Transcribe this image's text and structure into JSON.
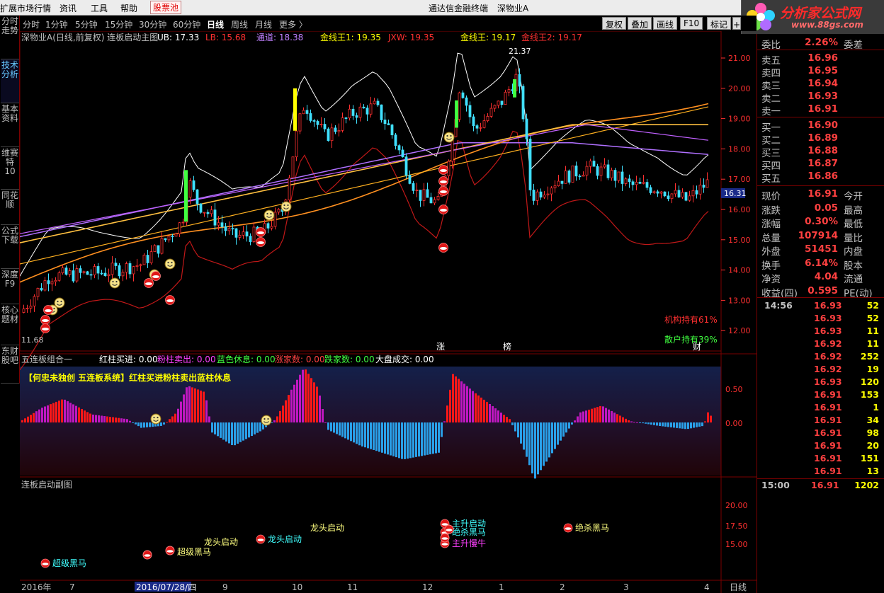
{
  "menu": {
    "items": [
      "扩展市场行情",
      "资讯",
      "工具",
      "帮助",
      "股票池"
    ],
    "center_items": [
      "通达信金融终端",
      "深物业A"
    ]
  },
  "logo": {
    "title": "分析家公式网",
    "url": "www.88gs.com"
  },
  "vtabs": [
    "分时走势",
    "技术分析",
    "基本资料",
    "维赛特10",
    "同花顺",
    "公式下载",
    "深度F9",
    "核心题材",
    "东财股吧"
  ],
  "toolbar": {
    "periods": [
      "分时",
      "1分钟",
      "5分钟",
      "15分钟",
      "30分钟",
      "60分钟",
      "日线",
      "周线",
      "月线",
      "更多 〉"
    ],
    "selected": "日线",
    "right_buttons": [
      "复权",
      "叠加",
      "画线",
      "F10",
      "标记"
    ],
    "right_tail": "+自"
  },
  "main_chart": {
    "title": "深物业A(日线,前复权) 连板启动主图",
    "indicators": [
      {
        "label": "UB: 17.33",
        "color": "#ffffff"
      },
      {
        "label": "LB: 15.68",
        "color": "#ff3030"
      },
      {
        "label": "通道: 18.38",
        "color": "#c080ff"
      },
      {
        "label": "金线王1: 19.35",
        "color": "#ffff00"
      },
      {
        "label": "JXW: 19.35",
        "color": "#ff3030"
      },
      {
        "label": "金线王: 19.17",
        "color": "#ffff00"
      },
      {
        "label": "金线王2: 19.17",
        "color": "#ff3030"
      }
    ],
    "y_ticks": [
      "21.00",
      "20.00",
      "19.00",
      "18.00",
      "17.00",
      "16.00",
      "15.00",
      "14.00",
      "13.00",
      "12.00"
    ],
    "high_label": "21.37",
    "low_label": "11.68",
    "current_price_tag": "16.31",
    "jigou": "机构持有61%",
    "sanhu": "散户持有39%",
    "markers": [
      "涨",
      "榜",
      "财"
    ]
  },
  "sub1": {
    "title": "五连板组合一",
    "values": [
      {
        "label": "红柱买进: 0.00",
        "color": "#ffffff"
      },
      {
        "label": "粉柱卖出: 0.00",
        "color": "#ff40ff"
      },
      {
        "label": "蓝色休息: 0.00",
        "color": "#40ff40"
      },
      {
        "label": "涨家数: 0.00",
        "color": "#ff4040"
      },
      {
        "label": "跌家数: 0.00",
        "color": "#40ff40"
      },
      {
        "label": "大盘成交: 0.00",
        "color": "#ffffff"
      }
    ],
    "banner": "【何忠未独创 五连板系统】红柱买进粉柱卖出蓝柱休息",
    "y_ticks": [
      "0.50",
      "0.00"
    ]
  },
  "sub2": {
    "title": "连板启动副图",
    "y_ticks": [
      "20.00",
      "17.50",
      "15.00"
    ],
    "labels": [
      "龙头启动",
      "绝杀黑马",
      "主升慢牛",
      "绝杀黑马",
      "主升启动",
      "超级黑马",
      "龙头启动",
      "龙头启动",
      "超级黑马"
    ]
  },
  "axis": {
    "dates": [
      "2016年",
      "7",
      "2016/07/28/四",
      "9",
      "10",
      "11",
      "12",
      "1",
      "2",
      "3",
      "4"
    ],
    "period_tag": "日线"
  },
  "quote": {
    "header_left": "委比",
    "header_val": "2.26%",
    "header_right": "委差",
    "sells": [
      {
        "label": "卖五",
        "price": "16.96"
      },
      {
        "label": "卖四",
        "price": "16.95"
      },
      {
        "label": "卖三",
        "price": "16.94"
      },
      {
        "label": "卖二",
        "price": "16.93"
      },
      {
        "label": "卖一",
        "price": "16.91"
      }
    ],
    "buys": [
      {
        "label": "买一",
        "price": "16.90"
      },
      {
        "label": "买二",
        "price": "16.89"
      },
      {
        "label": "买三",
        "price": "16.88"
      },
      {
        "label": "买四",
        "price": "16.87"
      },
      {
        "label": "买五",
        "price": "16.86"
      }
    ],
    "stats": [
      {
        "l": "现价",
        "v": "16.91",
        "r": "今开"
      },
      {
        "l": "涨跌",
        "v": "0.05",
        "r": "最高"
      },
      {
        "l": "涨幅",
        "v": "0.30%",
        "r": "最低"
      },
      {
        "l": "总量",
        "v": "107914",
        "r": "量比"
      },
      {
        "l": "外盘",
        "v": "51451",
        "r": "内盘"
      },
      {
        "l": "换手",
        "v": "6.14%",
        "r": "股本"
      },
      {
        "l": "净资",
        "v": "4.04",
        "r": "流通"
      },
      {
        "l": "收益(四)",
        "v": "0.595",
        "r": "PE(动)"
      }
    ],
    "ticks": [
      {
        "t": "14:56",
        "p": "16.93",
        "v": "52"
      },
      {
        "t": "",
        "p": "16.93",
        "v": "52"
      },
      {
        "t": "",
        "p": "16.93",
        "v": "11"
      },
      {
        "t": "",
        "p": "16.92",
        "v": "11"
      },
      {
        "t": "",
        "p": "16.92",
        "v": "252"
      },
      {
        "t": "",
        "p": "16.92",
        "v": "19"
      },
      {
        "t": "",
        "p": "16.93",
        "v": "120"
      },
      {
        "t": "",
        "p": "16.91",
        "v": "153"
      },
      {
        "t": "",
        "p": "16.91",
        "v": "1"
      },
      {
        "t": "",
        "p": "16.91",
        "v": "34"
      },
      {
        "t": "",
        "p": "16.91",
        "v": "98"
      },
      {
        "t": "",
        "p": "16.91",
        "v": "20"
      },
      {
        "t": "",
        "p": "16.91",
        "v": "151"
      },
      {
        "t": "",
        "p": "16.91",
        "v": "13"
      }
    ],
    "last": {
      "t": "15:00",
      "p": "16.91",
      "v": "1202"
    }
  }
}
